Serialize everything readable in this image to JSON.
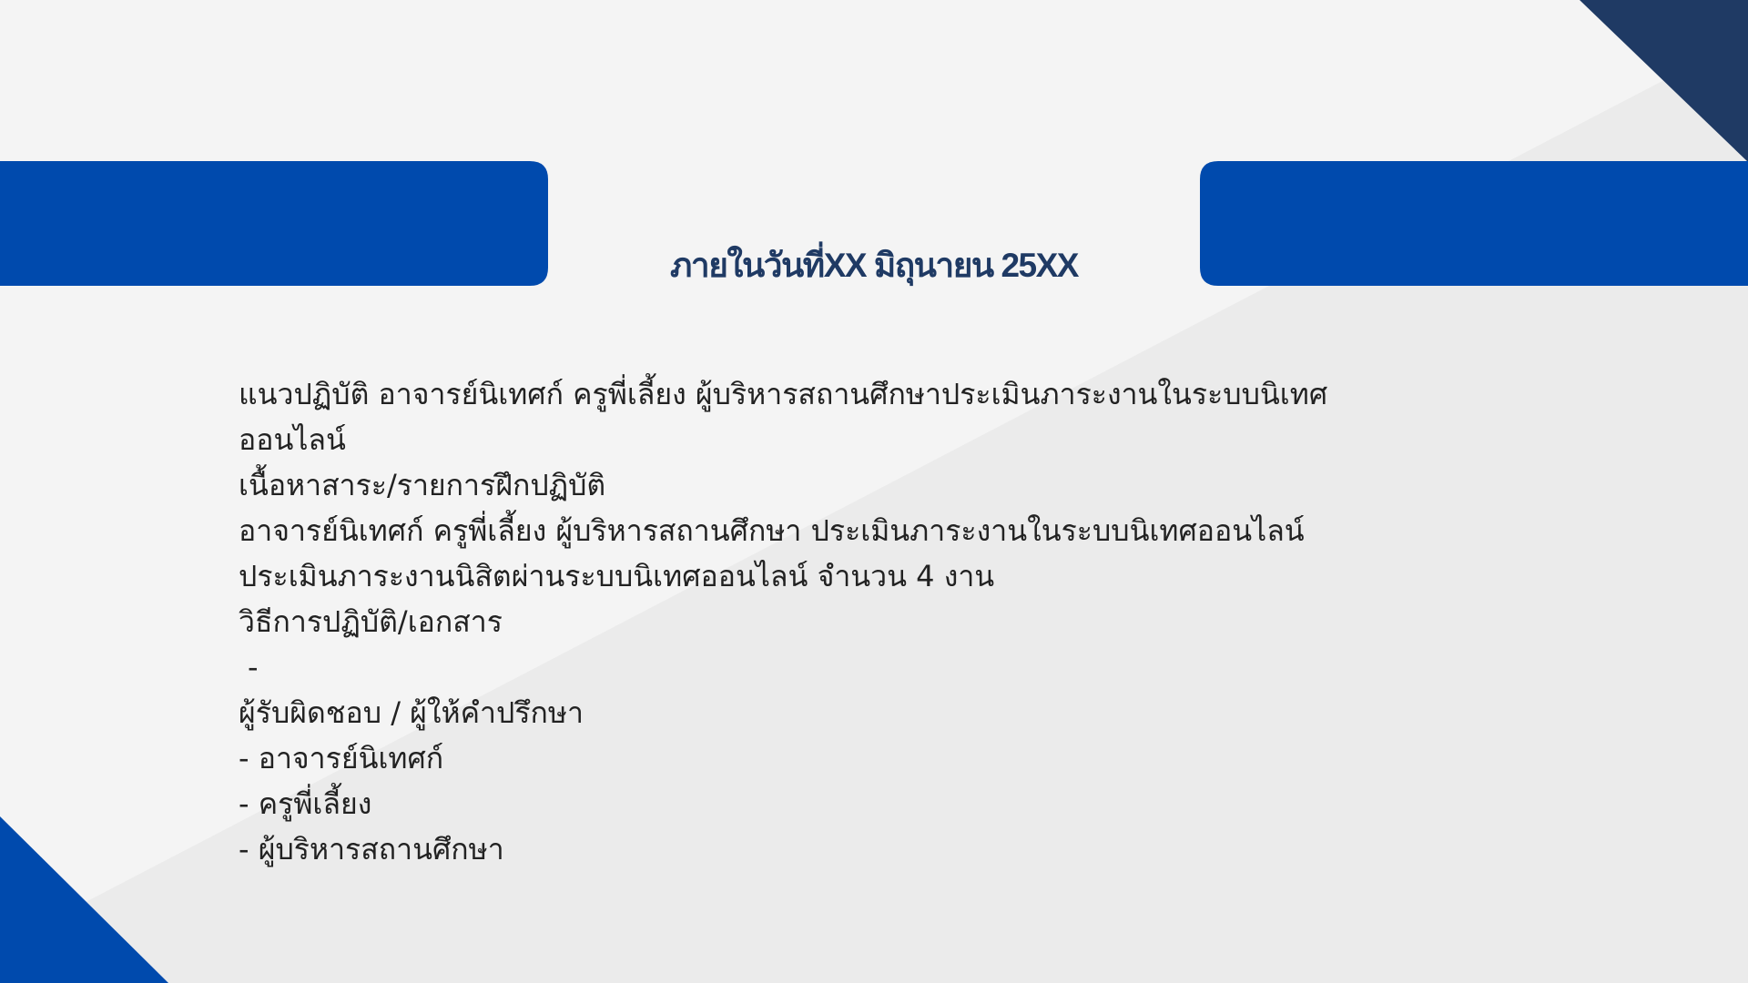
{
  "colors": {
    "background": "#f4f4f4",
    "diagonal_shade": "#ebebeb",
    "accent_blue": "#004aad",
    "navy": "#1f3a64",
    "text": "#222222"
  },
  "slide": {
    "title": "ภายในวันที่XX มิถุนายน 25XX",
    "lines": [
      "แนวปฏิบัติ อาจารย์นิเทศก์ ครูพี่เลี้ยง ผู้บริหารสถานศึกษาประเมินภาระงานในระบบนิเทศ",
      "ออนไลน์",
      "เนื้อหาสาระ/รายการฝึกปฏิบัติ",
      "อาจารย์นิเทศก์ ครูพี่เลี้ยง ผู้บริหารสถานศึกษา ประเมินภาระงานในระบบนิเทศออนไลน์",
      "ประเมินภาระงานนิสิตผ่านระบบนิเทศออนไลน์ จำนวน 4 งาน",
      "วิธีการปฏิบัติ/เอกสาร",
      "-",
      "ผู้รับผิดชอบ / ผู้ให้คำปรึกษา",
      "- อาจารย์นิเทศก์",
      "- ครูพี่เลี้ยง",
      "- ผู้บริหารสถานศึกษา"
    ]
  }
}
